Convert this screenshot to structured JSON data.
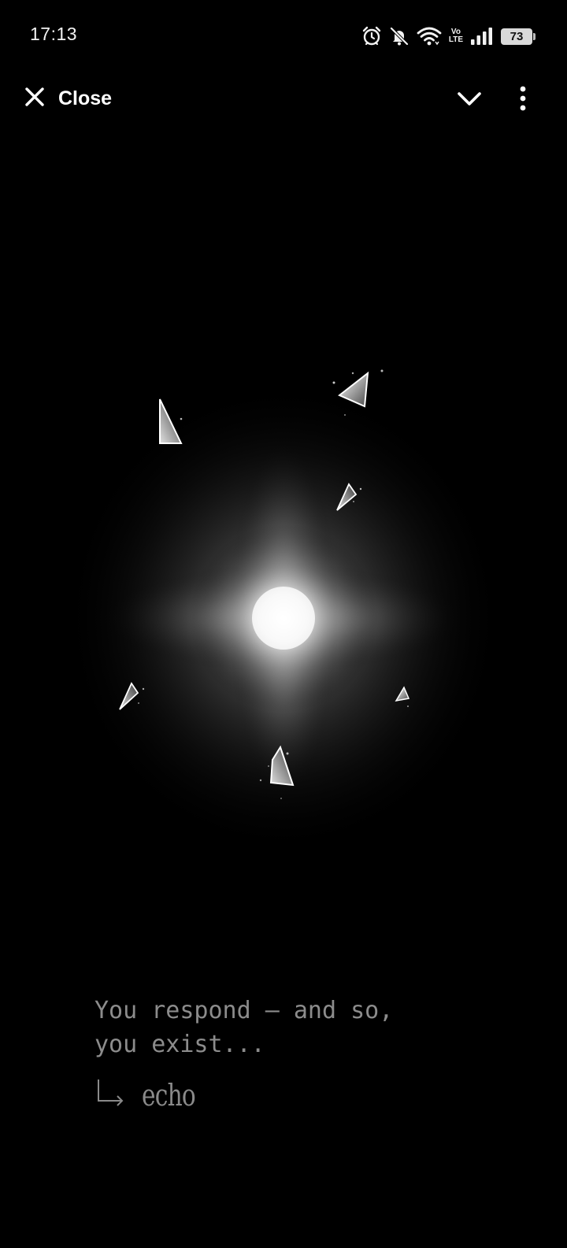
{
  "status_bar": {
    "time": "17:13",
    "volte_top": "Vo",
    "volte_bottom": "LTE",
    "battery_level": "73"
  },
  "top_bar": {
    "close_label": "Close"
  },
  "content": {
    "message_line_1": "You respond — and so,",
    "message_line_2": "you exist...",
    "echo_label": "echo"
  },
  "colors": {
    "background": "#000000",
    "message_text": "#8c8c8c",
    "glow_center": "#ffffff"
  }
}
